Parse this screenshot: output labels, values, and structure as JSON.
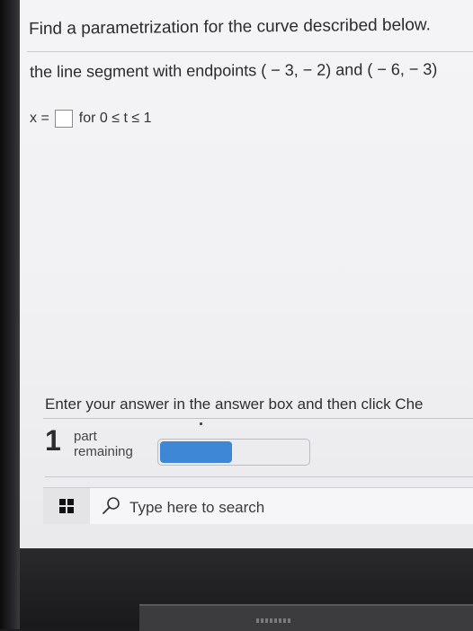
{
  "question": {
    "title": "Find a parametrization for the curve described below.",
    "description": "the line segment with endpoints ( − 3, − 2) and ( − 6, − 3)",
    "answer_label": "x =",
    "answer_value": "",
    "range_text": "for 0 ≤ t ≤ 1"
  },
  "footer": {
    "instruction": "Enter your answer in the answer box and then click Che",
    "parts_count": "1",
    "parts_label_line1": "part",
    "parts_label_line2": "remaining",
    "progress_fraction": 0.5
  },
  "taskbar": {
    "start_icon": "windows-logo-icon",
    "search_icon": "magnifier-icon",
    "search_placeholder": "Type here to search"
  },
  "colors": {
    "progress_fill": "#3e86d6",
    "text": "#2b2b2b"
  }
}
